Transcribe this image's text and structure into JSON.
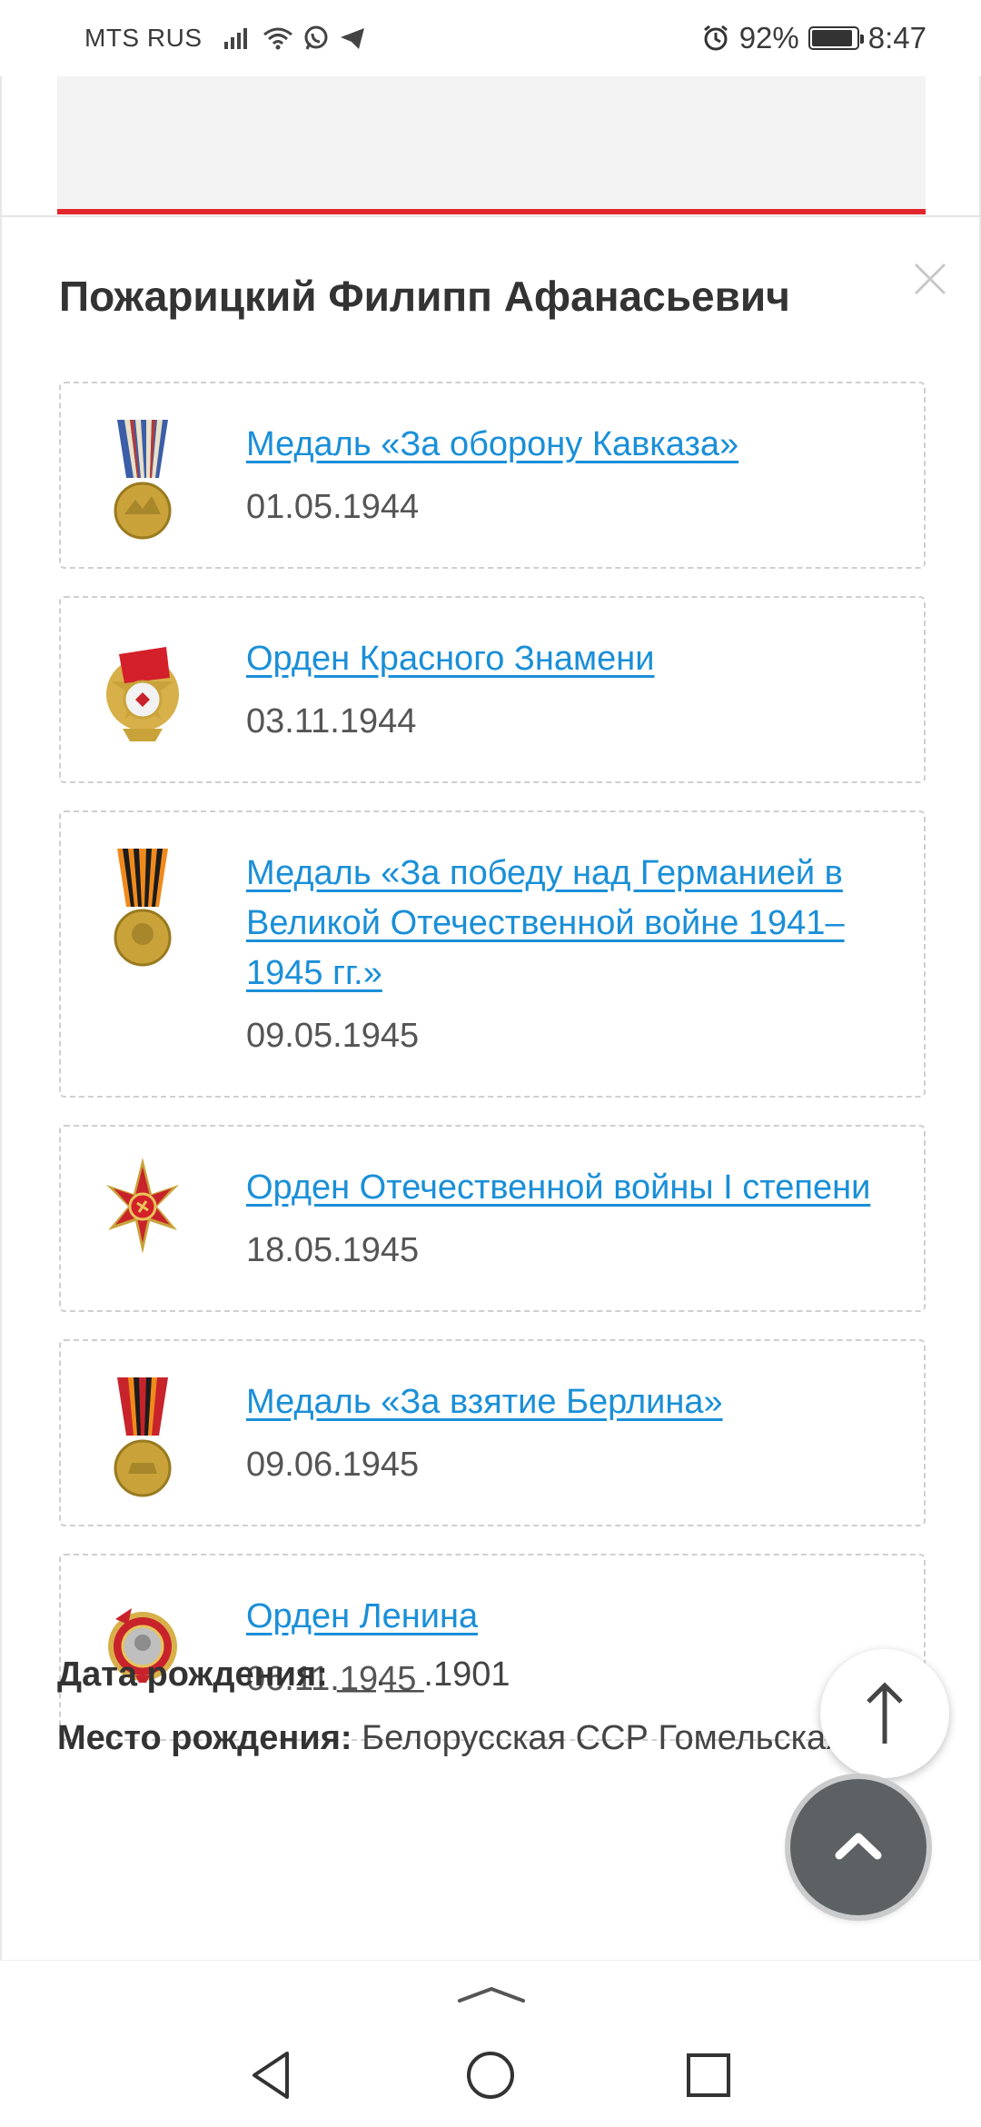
{
  "status_bar": {
    "carrier": "MTS RUS",
    "battery": "92%",
    "battery_level": 0.92,
    "time": "8:47",
    "icons": [
      "signal-icon",
      "wifi-icon",
      "whatsapp-icon",
      "telegram-icon",
      "alarm-icon",
      "battery-icon"
    ]
  },
  "modal": {
    "name": "Пожарицкий Филипп Афанасьевич",
    "awards": [
      {
        "title": "Медаль «За оборону Кавказа»",
        "date": "01.05.1944",
        "icon": "caucasus-medal-icon"
      },
      {
        "title": "Орден Красного Знамени",
        "date": "03.11.1944",
        "icon": "red-banner-order-icon"
      },
      {
        "title": "Медаль «За победу над Германией в Великой Отечественной войне 1941–1945 гг.»",
        "date": "09.05.1945",
        "icon": "victory-medal-icon"
      },
      {
        "title": "Орден Отечественной войны I степени",
        "date": "18.05.1945",
        "icon": "patriotic-war-order-icon"
      },
      {
        "title": "Медаль «За взятие Берлина»",
        "date": "09.06.1945",
        "icon": "berlin-medal-icon"
      },
      {
        "title": "Орден Ленина",
        "date": "06.11.1945",
        "icon": "lenin-order-icon"
      }
    ],
    "birth_label": "Дата рождения:",
    "birth_value": "__.__.1901",
    "place_label": "Место рождения:",
    "place_value": "Белорусская ССР Гомельская обл."
  },
  "colors": {
    "link": "#1a8fd8",
    "accent_red": "#e2262b",
    "fab_dark": "#5e6163"
  }
}
